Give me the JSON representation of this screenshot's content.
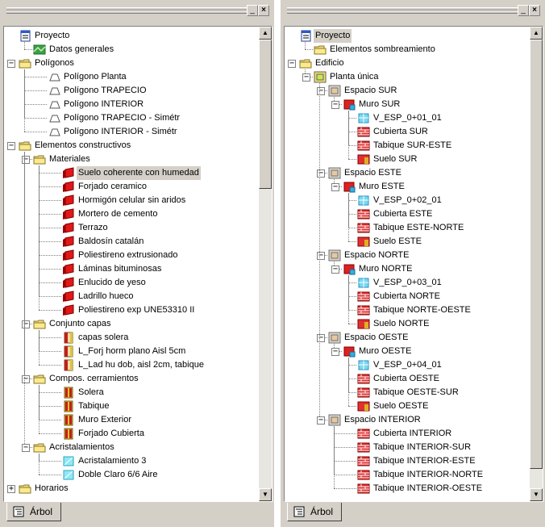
{
  "left_panel": {
    "tab_label": "Árbol",
    "title_buttons": {
      "minimize": "_",
      "close": "×"
    },
    "tree": [
      {
        "label": "Proyecto",
        "icon": "project",
        "depth": 0,
        "expander": "none"
      },
      {
        "label": "Datos generales",
        "icon": "general-data",
        "depth": 1,
        "expander": "none"
      },
      {
        "label": "Polígonos",
        "icon": "folder",
        "depth": 0,
        "expander": "minus"
      },
      {
        "label": "Polígono Planta",
        "icon": "polygon",
        "depth": 2,
        "expander": "none"
      },
      {
        "label": "Polígono TRAPECIO",
        "icon": "polygon",
        "depth": 2,
        "expander": "none"
      },
      {
        "label": "Polígono INTERIOR",
        "icon": "polygon",
        "depth": 2,
        "expander": "none"
      },
      {
        "label": "Polígono TRAPECIO - Simétr",
        "icon": "polygon",
        "depth": 2,
        "expander": "none"
      },
      {
        "label": "Polígono INTERIOR - Simétr",
        "icon": "polygon",
        "depth": 2,
        "expander": "none"
      },
      {
        "label": "Elementos constructivos",
        "icon": "folder",
        "depth": 0,
        "expander": "minus"
      },
      {
        "label": "Materiales",
        "icon": "folder",
        "depth": 1,
        "expander": "minus"
      },
      {
        "label": "Suelo coherente con humedad",
        "icon": "material",
        "depth": 3,
        "expander": "none",
        "selected": true
      },
      {
        "label": "Forjado ceramico",
        "icon": "material",
        "depth": 3,
        "expander": "none"
      },
      {
        "label": "Hormigón celular sin aridos",
        "icon": "material",
        "depth": 3,
        "expander": "none"
      },
      {
        "label": "Mortero de cemento",
        "icon": "material",
        "depth": 3,
        "expander": "none"
      },
      {
        "label": "Terrazo",
        "icon": "material",
        "depth": 3,
        "expander": "none"
      },
      {
        "label": "Baldosín catalán",
        "icon": "material",
        "depth": 3,
        "expander": "none"
      },
      {
        "label": "Poliestireno extrusionado",
        "icon": "material",
        "depth": 3,
        "expander": "none"
      },
      {
        "label": "Láminas bituminosas",
        "icon": "material",
        "depth": 3,
        "expander": "none"
      },
      {
        "label": "Enlucido de yeso",
        "icon": "material",
        "depth": 3,
        "expander": "none"
      },
      {
        "label": "Ladrillo hueco",
        "icon": "material",
        "depth": 3,
        "expander": "none"
      },
      {
        "label": "Poliestireno exp UNE53310 II",
        "icon": "material",
        "depth": 3,
        "expander": "none"
      },
      {
        "label": "Conjunto capas",
        "icon": "folder",
        "depth": 1,
        "expander": "minus"
      },
      {
        "label": "capas solera",
        "icon": "layers",
        "depth": 3,
        "expander": "none"
      },
      {
        "label": "L_Forj horm plano Aisl 5cm",
        "icon": "layers",
        "depth": 3,
        "expander": "none"
      },
      {
        "label": "L_Lad hu dob, aisl 2cm, tabique",
        "icon": "layers",
        "depth": 3,
        "expander": "none"
      },
      {
        "label": "Compos. cerramientos",
        "icon": "folder",
        "depth": 1,
        "expander": "minus"
      },
      {
        "label": "Solera",
        "icon": "enclosure",
        "depth": 3,
        "expander": "none"
      },
      {
        "label": "Tabique",
        "icon": "enclosure",
        "depth": 3,
        "expander": "none"
      },
      {
        "label": "Muro Exterior",
        "icon": "enclosure",
        "depth": 3,
        "expander": "none"
      },
      {
        "label": "Forjado Cubierta",
        "icon": "enclosure",
        "depth": 3,
        "expander": "none"
      },
      {
        "label": "Acristalamientos",
        "icon": "folder",
        "depth": 1,
        "expander": "minus"
      },
      {
        "label": "Acristalamiento 3",
        "icon": "glazing",
        "depth": 3,
        "expander": "none"
      },
      {
        "label": "Doble Claro 6/6 Aire",
        "icon": "glazing",
        "depth": 3,
        "expander": "none"
      },
      {
        "label": "Horarios",
        "icon": "folder",
        "depth": 0,
        "expander": "plus"
      }
    ]
  },
  "right_panel": {
    "tab_label": "Árbol",
    "title_buttons": {
      "minimize": "_",
      "close": "×"
    },
    "tree": [
      {
        "label": "Proyecto",
        "icon": "project",
        "depth": 0,
        "expander": "none",
        "selected": true
      },
      {
        "label": "Elementos sombreamiento",
        "icon": "folder",
        "depth": 1,
        "expander": "none"
      },
      {
        "label": "Edificio",
        "icon": "folder",
        "depth": 0,
        "expander": "minus"
      },
      {
        "label": "Planta única",
        "icon": "floor",
        "depth": 1,
        "expander": "minus"
      },
      {
        "label": "Espacio SUR",
        "icon": "space",
        "depth": 2,
        "expander": "minus"
      },
      {
        "label": "Muro SUR",
        "icon": "wall",
        "depth": 3,
        "expander": "minus"
      },
      {
        "label": "V_ESP_0+01_01",
        "icon": "window",
        "depth": 4,
        "expander": "none"
      },
      {
        "label": "Cubierta SUR",
        "icon": "roof",
        "depth": 4,
        "expander": "none"
      },
      {
        "label": "Tabique SUR-ESTE",
        "icon": "roof",
        "depth": 4,
        "expander": "none"
      },
      {
        "label": "Suelo SUR",
        "icon": "floor-slab",
        "depth": 4,
        "expander": "none"
      },
      {
        "label": "Espacio ESTE",
        "icon": "space",
        "depth": 2,
        "expander": "minus"
      },
      {
        "label": "Muro ESTE",
        "icon": "wall",
        "depth": 3,
        "expander": "minus"
      },
      {
        "label": "V_ESP_0+02_01",
        "icon": "window",
        "depth": 4,
        "expander": "none"
      },
      {
        "label": "Cubierta ESTE",
        "icon": "roof",
        "depth": 4,
        "expander": "none"
      },
      {
        "label": "Tabique ESTE-NORTE",
        "icon": "roof",
        "depth": 4,
        "expander": "none"
      },
      {
        "label": "Suelo ESTE",
        "icon": "floor-slab",
        "depth": 4,
        "expander": "none"
      },
      {
        "label": "Espacio NORTE",
        "icon": "space",
        "depth": 2,
        "expander": "minus"
      },
      {
        "label": "Muro NORTE",
        "icon": "wall",
        "depth": 3,
        "expander": "minus"
      },
      {
        "label": "V_ESP_0+03_01",
        "icon": "window",
        "depth": 4,
        "expander": "none"
      },
      {
        "label": "Cubierta NORTE",
        "icon": "roof",
        "depth": 4,
        "expander": "none"
      },
      {
        "label": "Tabique NORTE-OESTE",
        "icon": "roof",
        "depth": 4,
        "expander": "none"
      },
      {
        "label": "Suelo NORTE",
        "icon": "floor-slab",
        "depth": 4,
        "expander": "none"
      },
      {
        "label": "Espacio OESTE",
        "icon": "space",
        "depth": 2,
        "expander": "minus"
      },
      {
        "label": "Muro OESTE",
        "icon": "wall",
        "depth": 3,
        "expander": "minus"
      },
      {
        "label": "V_ESP_0+04_01",
        "icon": "window",
        "depth": 4,
        "expander": "none"
      },
      {
        "label": "Cubierta OESTE",
        "icon": "roof",
        "depth": 4,
        "expander": "none"
      },
      {
        "label": "Tabique OESTE-SUR",
        "icon": "roof",
        "depth": 4,
        "expander": "none"
      },
      {
        "label": "Suelo OESTE",
        "icon": "floor-slab",
        "depth": 4,
        "expander": "none"
      },
      {
        "label": "Espacio INTERIOR",
        "icon": "space",
        "depth": 2,
        "expander": "minus"
      },
      {
        "label": "Cubierta INTERIOR",
        "icon": "roof",
        "depth": 4,
        "expander": "none"
      },
      {
        "label": "Tabique INTERIOR-SUR",
        "icon": "roof",
        "depth": 4,
        "expander": "none"
      },
      {
        "label": "Tabique INTERIOR-ESTE",
        "icon": "roof",
        "depth": 4,
        "expander": "none"
      },
      {
        "label": "Tabique INTERIOR-NORTE",
        "icon": "roof",
        "depth": 4,
        "expander": "none"
      },
      {
        "label": "Tabique INTERIOR-OESTE",
        "icon": "roof",
        "depth": 4,
        "expander": "none"
      }
    ]
  }
}
